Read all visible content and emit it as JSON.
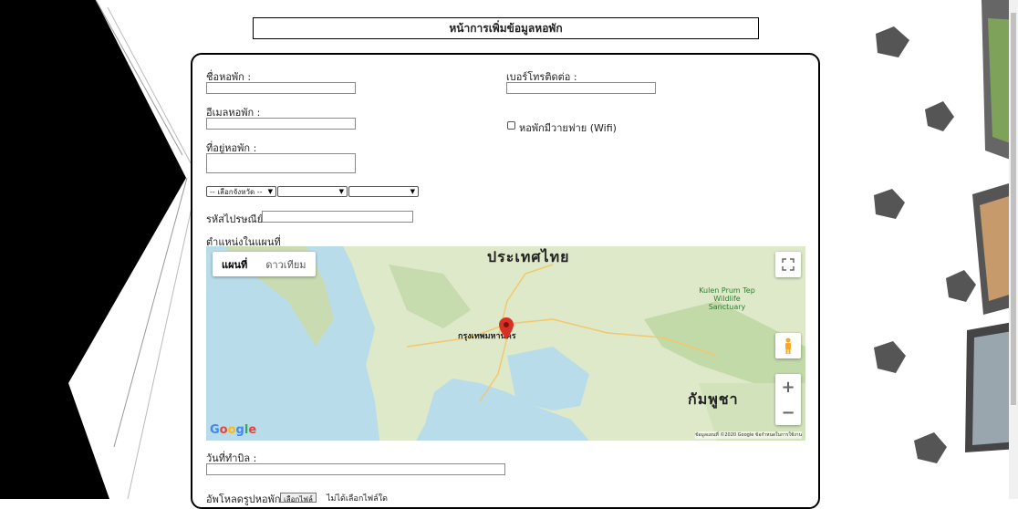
{
  "page_title": "หน้าการเพิ่มข้อมูลหอพัก",
  "form": {
    "dorm_name_label": "ชื่อหอพัก :",
    "phone_label": "เบอร์โทรติดต่อ :",
    "email_label": "อีเมลหอพัก :",
    "wifi_label": "หอพักมีวายฟาย (Wifi)",
    "address_label": "ที่อยู่หอพัก :",
    "province_select": "-- เลือกจังหวัด --",
    "postal_label": "รหัสไปรษณีย์ :",
    "map_label": "ตำแหน่งในแผนที่",
    "payment_date_label": "วันที่ทำบิล :",
    "upload_label": "อัพโหลดรูปหอพัก :",
    "file_button": "เลือกไฟล์",
    "no_file_text": "ไม่ได้เลือกไฟล์ใด"
  },
  "map": {
    "tab_map": "แผนที่",
    "tab_satellite": "ดาวเทียม",
    "country_label": "ประเทศไทย",
    "cambodia_label": "กัมพูชา",
    "bangkok_label": "กรุงเทพมหานคร",
    "park_label": "Kulen Prum Tep Wildlife Sanctuary",
    "google_logo": "Google",
    "copyright": "ข้อมูลแผนที่ ©2020 Google ข้อกำหนดในการใช้งาน",
    "zoom_in": "+",
    "zoom_out": "−"
  },
  "colors": {
    "water": "#b8dcea",
    "land": "#dde9c8",
    "pin": "#d93025"
  }
}
